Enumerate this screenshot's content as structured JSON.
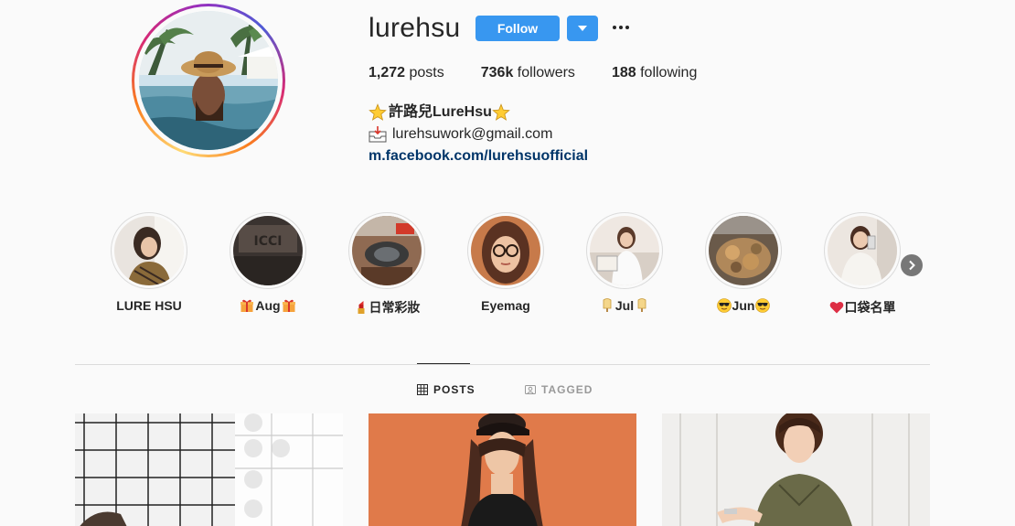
{
  "profile": {
    "username": "lurehsu",
    "follow_label": "Follow",
    "stats": {
      "posts_count": "1,272",
      "posts_label": "posts",
      "followers_count": "736k",
      "followers_label": "followers",
      "following_count": "188",
      "following_label": "following"
    },
    "bio": {
      "display_name": "許路兒LureHsu",
      "email": "lurehsuwork@gmail.com",
      "link": "m.facebook.com/lurehsuofficial"
    }
  },
  "highlights": [
    {
      "label": "LURE HSU",
      "emoji_before": "",
      "emoji_after": ""
    },
    {
      "label": "Aug",
      "emoji_before": "gift-icon",
      "emoji_after": "gift-icon"
    },
    {
      "label": "日常彩妝",
      "emoji_before": "lipstick-icon",
      "emoji_after": ""
    },
    {
      "label": "Eyemag",
      "emoji_before": "",
      "emoji_after": ""
    },
    {
      "label": "Jul",
      "emoji_before": "popsicle-icon",
      "emoji_after": "popsicle-icon"
    },
    {
      "label": "Jun",
      "emoji_before": "sunglasses-face-icon",
      "emoji_after": "sunglasses-face-icon"
    },
    {
      "label": "口袋名單",
      "emoji_before": "heart-icon",
      "emoji_after": ""
    }
  ],
  "tabs": {
    "posts": "POSTS",
    "tagged": "TAGGED"
  },
  "colors": {
    "follow_blue": "#3897f0",
    "link_blue": "#003569",
    "background": "#fafafa"
  }
}
